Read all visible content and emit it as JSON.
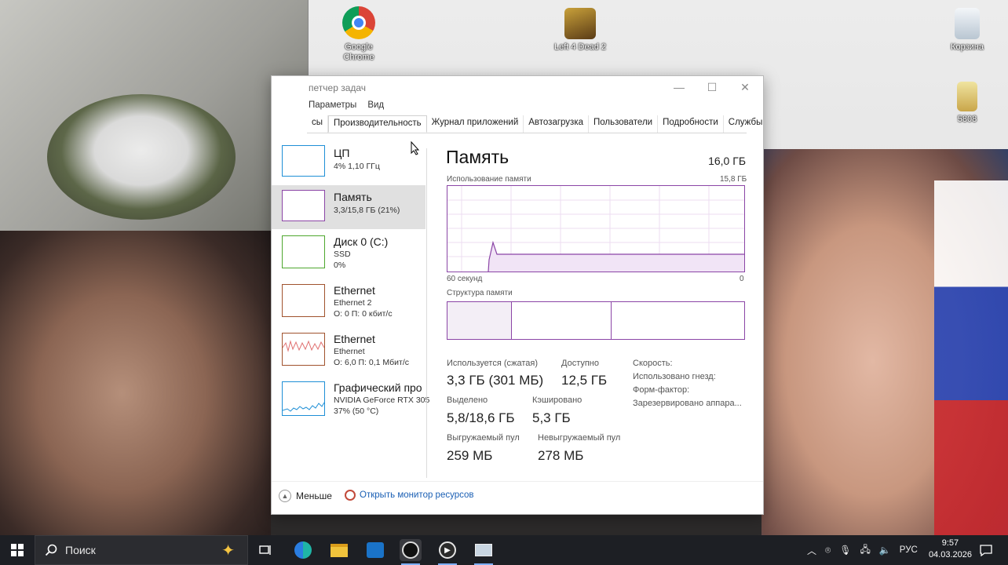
{
  "desktop": {
    "icons": [
      {
        "label": "Google Chrome",
        "icon": "chrome-icon"
      },
      {
        "label": "Left 4 Dead 2",
        "icon": "game-icon"
      },
      {
        "label": "Корзина",
        "icon": "recycle-bin-icon"
      },
      {
        "label": "5808",
        "icon": "file-icon"
      }
    ]
  },
  "taskmanager": {
    "title": "петчер задач",
    "menu": [
      "Параметры",
      "Вид"
    ],
    "tabs": [
      "сы",
      "Производительность",
      "Журнал приложений",
      "Автозагрузка",
      "Пользователи",
      "Подробности",
      "Службы"
    ],
    "active_tab": "Производительность",
    "sidebar": [
      {
        "name": "ЦП",
        "sub1": "4% 1,10 ГГц",
        "sub2": "",
        "sub3": "",
        "color": "#1e8fd6"
      },
      {
        "name": "Память",
        "sub1": "3,3/15,8 ГБ (21%)",
        "sub2": "",
        "sub3": "",
        "color": "#8b45a6"
      },
      {
        "name": "Диск 0 (C:)",
        "sub1": "SSD",
        "sub2": "0%",
        "sub3": "",
        "color": "#4ea72e"
      },
      {
        "name": "Ethernet",
        "sub1": "Ethernet 2",
        "sub2": "О: 0 П: 0 кбит/с",
        "sub3": "",
        "color": "#a0522d"
      },
      {
        "name": "Ethernet",
        "sub1": "Ethernet",
        "sub2": "О: 6,0 П: 0,1 Мбит/с",
        "sub3": "",
        "color": "#a0522d"
      },
      {
        "name": "Графический про",
        "sub1": "NVIDIA GeForce RTX 305",
        "sub2": "37% (50 °C)",
        "sub3": "",
        "color": "#1e8fd6"
      }
    ],
    "main": {
      "title": "Память",
      "total": "16,0 ГБ",
      "usage_label": "Использование памяти",
      "usage_max": "15,8 ГБ",
      "axis_left": "60 секунд",
      "axis_right": "0",
      "structure_label": "Структура памяти",
      "stats": {
        "in_use_label": "Используется (сжатая)",
        "in_use": "3,3 ГБ (301 МБ)",
        "available_label": "Доступно",
        "available": "12,5 ГБ",
        "committed_label": "Выделено",
        "committed": "5,8/18,6 ГБ",
        "cached_label": "Кэшировано",
        "cached": "5,3 ГБ",
        "paged_label": "Выгружаемый пул",
        "paged": "259 МБ",
        "nonpaged_label": "Невыгружаемый пул",
        "nonpaged": "278 МБ"
      },
      "specs": [
        "Скорость:",
        "Использовано гнезд:",
        "Форм-фактор:",
        "Зарезервировано аппара..."
      ]
    },
    "footer": {
      "less": "Меньше",
      "monitor_link": "Открыть монитор ресурсов"
    }
  },
  "taskbar": {
    "search_placeholder": "Поиск",
    "lang": "РУС",
    "time": "9:57",
    "date": "04.03.2026"
  }
}
